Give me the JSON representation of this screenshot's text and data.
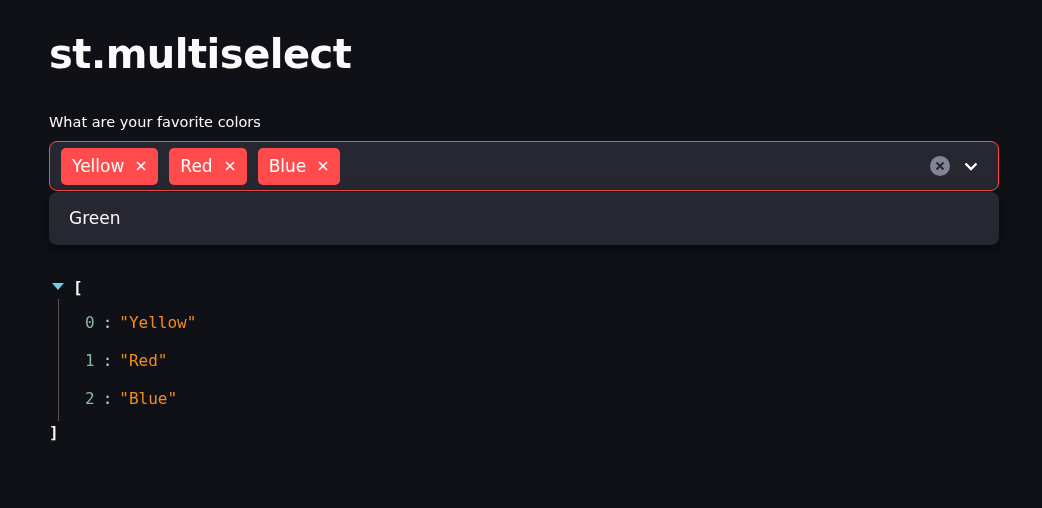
{
  "title": "st.multiselect",
  "multiselect": {
    "label": "What are your favorite colors",
    "focused": true,
    "dropdown_open": true,
    "tags": [
      {
        "label": "Yellow"
      },
      {
        "label": "Red"
      },
      {
        "label": "Blue"
      }
    ],
    "options": [
      {
        "label": "Green",
        "selected": false
      }
    ]
  },
  "json_view": {
    "expanded": true,
    "open_bracket": "[",
    "close_bracket": "]",
    "entries": [
      {
        "index": "0",
        "separator": ":",
        "value": "\"Yellow\""
      },
      {
        "index": "1",
        "separator": ":",
        "value": "\"Red\""
      },
      {
        "index": "2",
        "separator": ":",
        "value": "\"Blue\""
      }
    ]
  }
}
